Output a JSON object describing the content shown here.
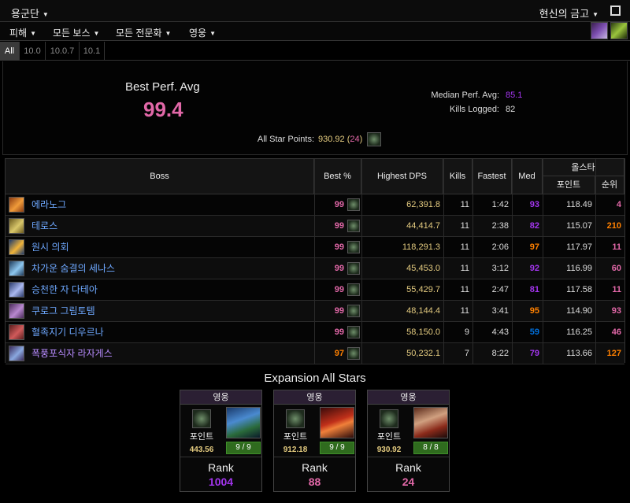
{
  "topbar": {
    "zone": "용군단",
    "right_menu": "현신의 금고"
  },
  "menubar": {
    "items": [
      "피해",
      "모든 보스",
      "모든 전문화",
      "영웅"
    ]
  },
  "tabs": [
    "All",
    "10.0",
    "10.0.7",
    "10.1"
  ],
  "summary": {
    "best_perf_label": "Best Perf. Avg",
    "best_perf_value": "99.4",
    "median_label": "Median Perf. Avg:",
    "median_value": "85.1",
    "kills_label": "Kills Logged:",
    "kills_value": "82",
    "all_star_label": "All Star Points:",
    "all_star_value": "930.92",
    "all_star_rank": "24"
  },
  "table": {
    "headers": {
      "boss": "Boss",
      "best": "Best %",
      "dps": "Highest DPS",
      "kills": "Kills",
      "fastest": "Fastest",
      "med": "Med",
      "allstar": "올스타",
      "points": "포인트",
      "rank": "순위"
    },
    "rows": [
      {
        "name": "에라노그",
        "best": "99",
        "dps": "62,391.8",
        "kills": "11",
        "fastest": "1:42",
        "med": "93",
        "points": "118.49",
        "rank": "4"
      },
      {
        "name": "테로스",
        "best": "99",
        "dps": "44,414.7",
        "kills": "11",
        "fastest": "2:38",
        "med": "82",
        "points": "115.07",
        "rank": "210"
      },
      {
        "name": "원시 의회",
        "best": "99",
        "dps": "118,291.3",
        "kills": "11",
        "fastest": "2:06",
        "med": "97",
        "points": "117.97",
        "rank": "11"
      },
      {
        "name": "차가운 숨결의 세나스",
        "best": "99",
        "dps": "45,453.0",
        "kills": "11",
        "fastest": "3:12",
        "med": "92",
        "points": "116.99",
        "rank": "60"
      },
      {
        "name": "승천한 자 다테아",
        "best": "99",
        "dps": "55,429.7",
        "kills": "11",
        "fastest": "2:47",
        "med": "81",
        "points": "117.58",
        "rank": "11"
      },
      {
        "name": "쿠로그 그림토템",
        "best": "99",
        "dps": "48,144.4",
        "kills": "11",
        "fastest": "3:41",
        "med": "95",
        "points": "114.90",
        "rank": "93"
      },
      {
        "name": "혈족지기 디우르나",
        "best": "99",
        "dps": "58,150.0",
        "kills": "9",
        "fastest": "4:43",
        "med": "59",
        "points": "116.25",
        "rank": "46"
      },
      {
        "name": "폭풍포식자 라자게스",
        "best": "97",
        "dps": "50,232.1",
        "kills": "7",
        "fastest": "8:22",
        "med": "79",
        "points": "113.66",
        "rank": "127"
      }
    ]
  },
  "expansion": {
    "title": "Expansion All Stars",
    "cards": [
      {
        "title": "영웅",
        "label": "포인트",
        "points": "443.56",
        "frac": "9 / 9",
        "rank_label": "Rank",
        "rank": "1004",
        "rank_color": "#a335ee"
      },
      {
        "title": "영웅",
        "label": "포인트",
        "points": "912.18",
        "frac": "9 / 9",
        "rank_label": "Rank",
        "rank": "88",
        "rank_color": "#e268a8"
      },
      {
        "title": "영웅",
        "label": "포인트",
        "points": "930.92",
        "frac": "8 / 8",
        "rank_label": "Rank",
        "rank": "24",
        "rank_color": "#e268a8"
      }
    ]
  }
}
